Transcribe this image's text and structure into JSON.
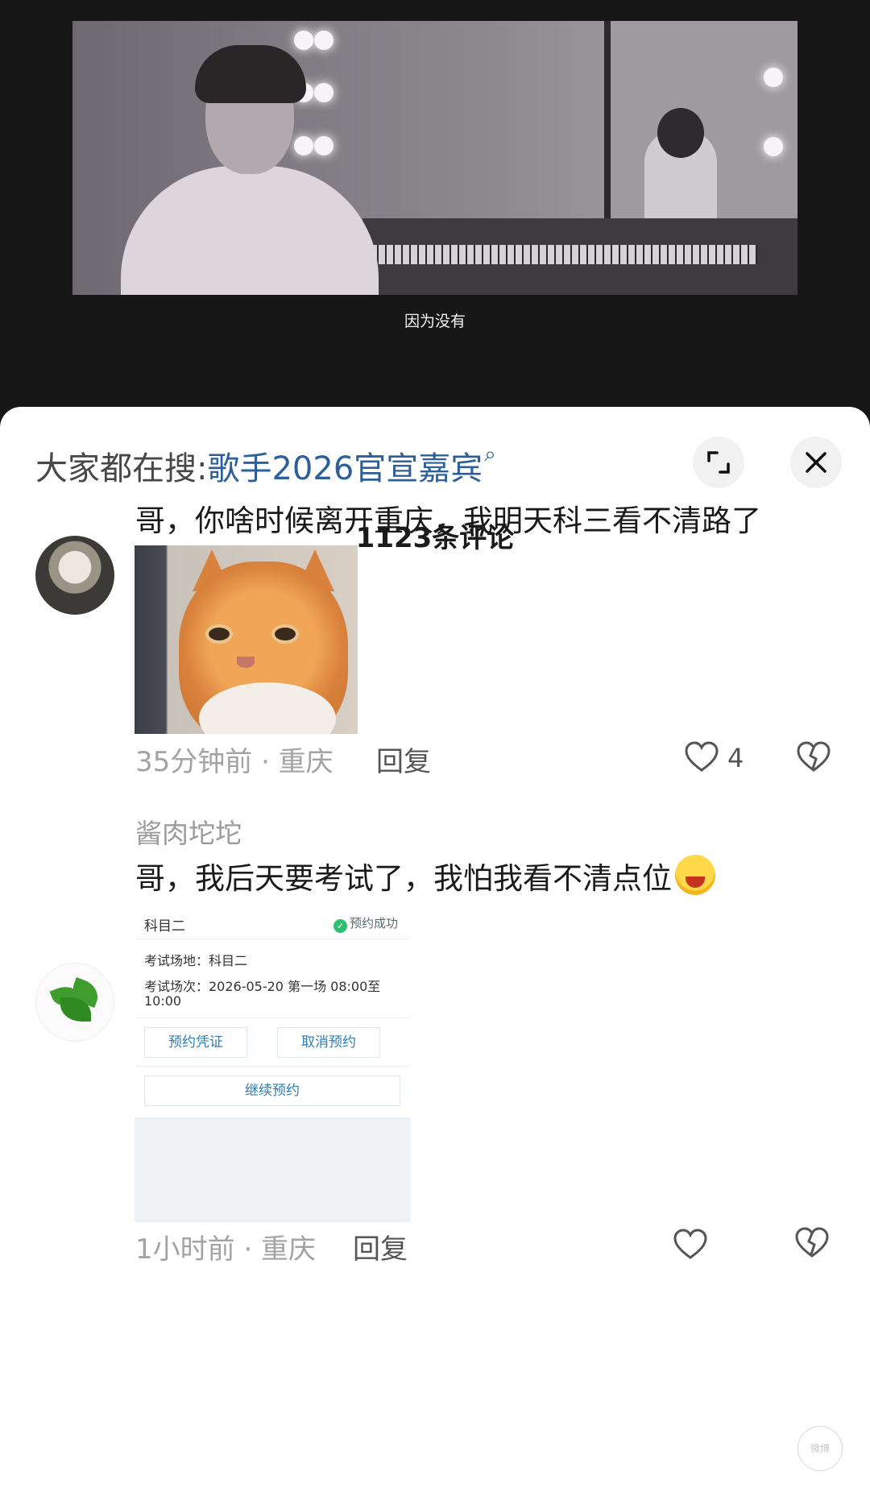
{
  "video": {
    "subtitle": "因为没有"
  },
  "search": {
    "prefix": "大家都在搜:",
    "term": "歌手2026官宣嘉宾",
    "icon": "search-icon"
  },
  "header": {
    "comment_count": "1123条评论",
    "expand_icon": "expand-icon",
    "close_icon": "close-icon"
  },
  "comments": [
    {
      "text": "哥，你啥时候离开重庆，我明天科三看不清路了",
      "time_location": "35分钟前 · 重庆",
      "reply_label": "回复",
      "like_count": "4",
      "image": "crying-cat-meme"
    },
    {
      "username": "酱肉坨坨",
      "text": "哥，我后天要考试了，我怕我看不清点位",
      "emoji": "laughing-crying-emoji",
      "time_location": "1小时前 · 重庆",
      "reply_label": "回复",
      "screenshot": {
        "subject": "科目二",
        "status": "预约成功",
        "venue": "考试场地：科目二",
        "session_line1": "考试场次：2026-05-20 第一场 08:00至",
        "session_line2": "10:00",
        "btn_voucher": "预约凭证",
        "btn_cancel": "取消预约",
        "btn_continue": "继续预约"
      }
    }
  ],
  "colors": {
    "search_term": "#2d5f9a",
    "meta_text": "#a3a3a3",
    "card_button_text": "#2f7fb3",
    "success_green": "#2fbf71"
  },
  "watermark": "微博"
}
